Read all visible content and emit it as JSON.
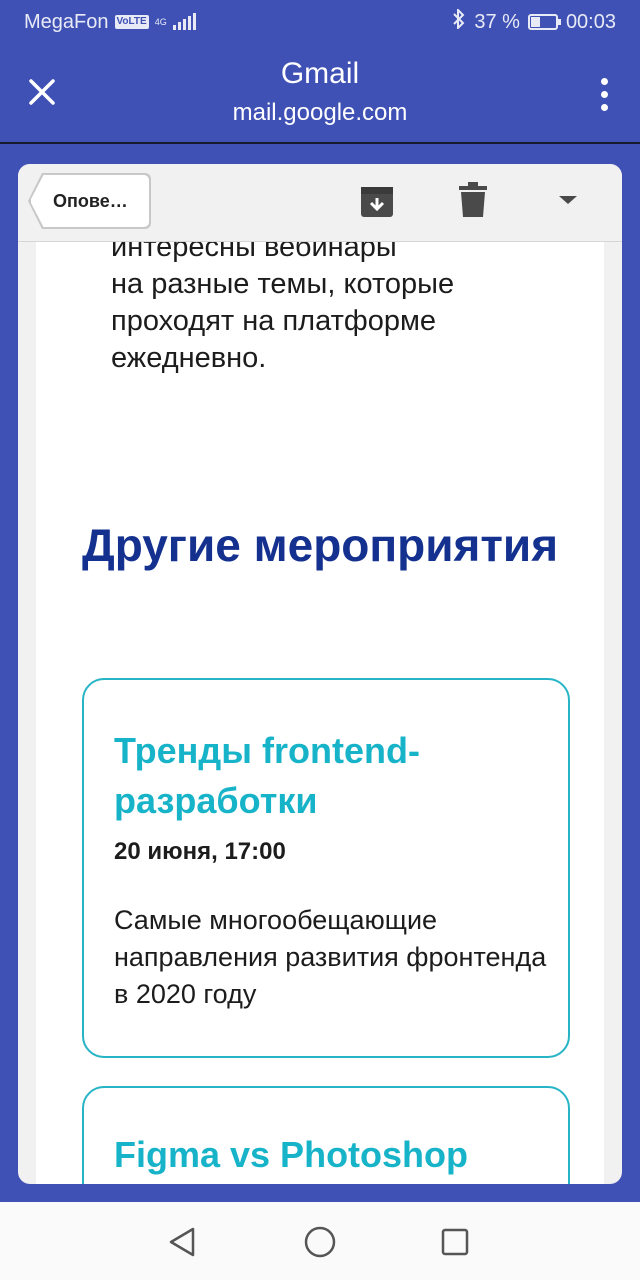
{
  "status_bar": {
    "carrier": "MegaFon",
    "volte": "VoLTE",
    "network": "4G",
    "battery_percent": "37 %",
    "battery_level": 0.37,
    "time": "00:03"
  },
  "app_bar": {
    "title": "Gmail",
    "subtitle": "mail.google.com"
  },
  "toolbar": {
    "back_label": "Опове…"
  },
  "email": {
    "intro_lines": [
      "интересны вебинары",
      "на разные темы, которые",
      "проходят на платформе",
      "ежедневно."
    ],
    "section_title": "Другие мероприятия",
    "events": [
      {
        "title": "Тренды frontend-разработки",
        "date": "20 июня, 17:00",
        "description": "Самые многообещающие направления развития фронтенда в 2020 году"
      },
      {
        "title": "Figma vs Photoshop"
      }
    ]
  },
  "colors": {
    "app_bar": "#3f51b5",
    "section_title": "#14318f",
    "event_accent": "#17b3c8"
  }
}
